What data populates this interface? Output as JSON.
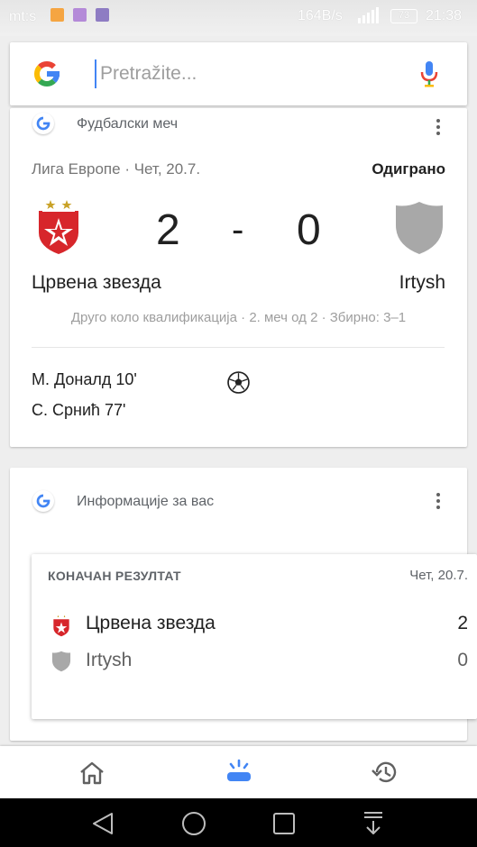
{
  "status_bar": {
    "carrier": "mt:s",
    "speed": "164B/s",
    "battery": "73",
    "time": "21:38"
  },
  "search": {
    "placeholder": "Pretražite..."
  },
  "match_card": {
    "source": "Фудбалски меч",
    "league_date": "Лига Европе · Чет, 20.7.",
    "status": "Одиграно",
    "home": {
      "name": "Црвена звезда",
      "score": "2"
    },
    "separator": "-",
    "away": {
      "name": "Irtysh",
      "score": "0"
    },
    "round_info": "Друго коло квалификација · 2. меч од 2 · Збирно: 3–1",
    "scorers": [
      "М. Доналд 10'",
      "С. Срнић 77'"
    ]
  },
  "info_card": {
    "source": "Информације за вас",
    "result": {
      "label": "КОНАЧАН РЕЗУЛТАТ",
      "date": "Чет, 20.7.",
      "rows": [
        {
          "team": "Црвена звезда",
          "score": "2"
        },
        {
          "team": "Irtysh",
          "score": "0"
        }
      ]
    }
  },
  "colors": {
    "accent": "#4285f4",
    "crvena_red": "#d7262b",
    "shield_grey": "#a8a8a8"
  },
  "icons": [
    "google-logo-icon",
    "microphone-icon",
    "more-vert-icon",
    "soccer-ball-icon",
    "home-icon",
    "updates-icon",
    "history-icon",
    "back-icon",
    "circle-home-icon",
    "recents-icon",
    "notifications-pull-icon"
  ]
}
